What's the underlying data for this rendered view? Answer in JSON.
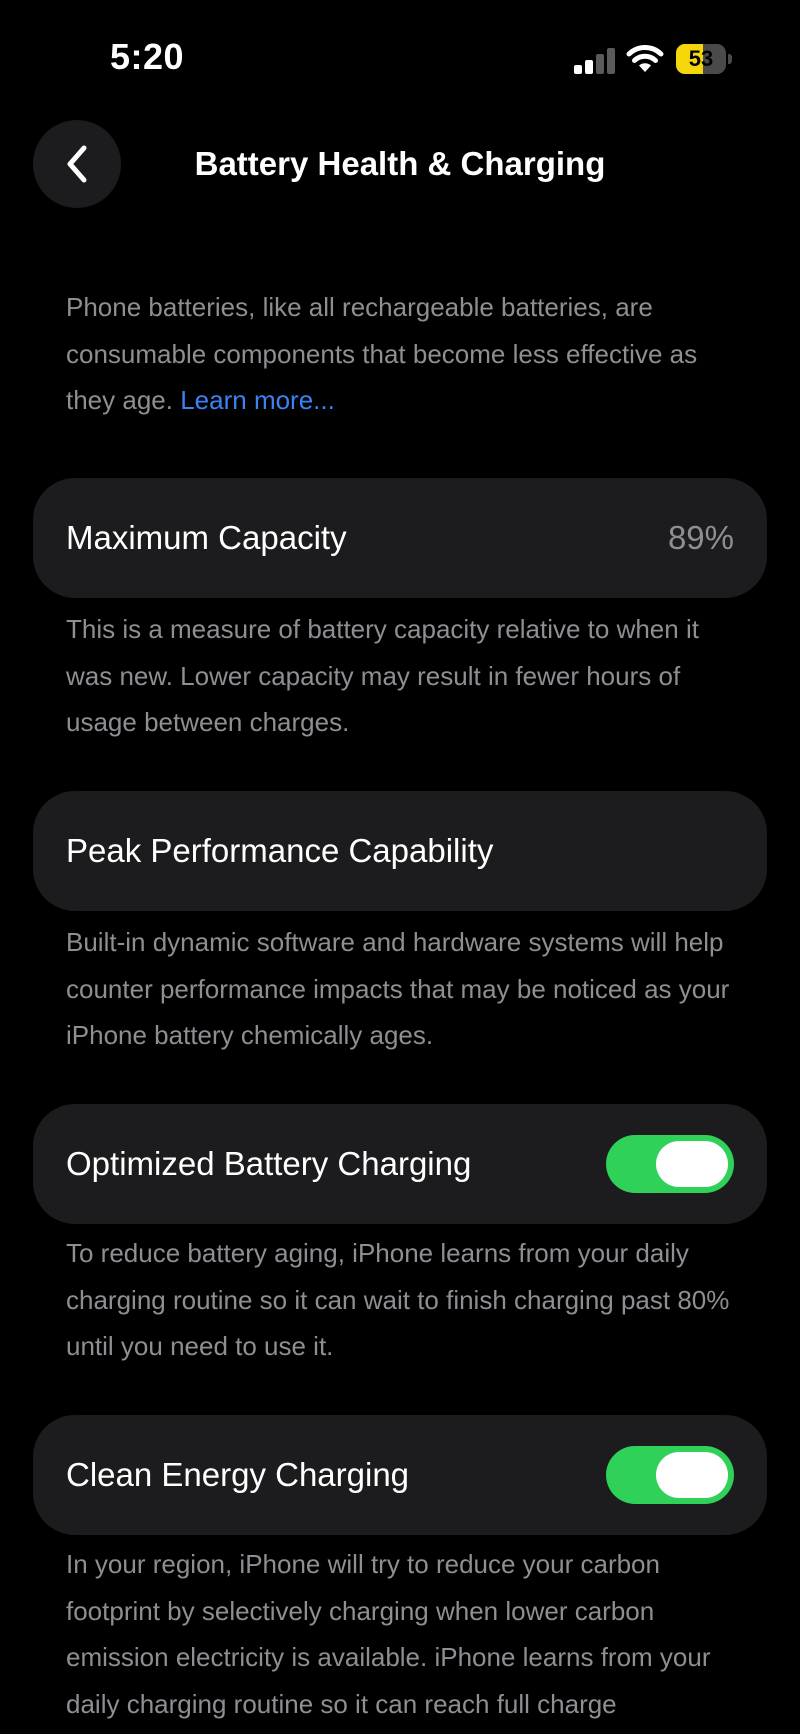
{
  "status_bar": {
    "time": "5:20",
    "battery_level": "53",
    "battery_fraction": 0.53,
    "icons": [
      "cellular-signal-icon",
      "wifi-icon",
      "battery-icon"
    ],
    "battery_color": "#f5d60a"
  },
  "nav": {
    "back_icon": "chevron-left-icon",
    "title": "Battery Health & Charging"
  },
  "intro": {
    "text": "Phone batteries, like all rechargeable batteries, are consumable components that become less effective as they age.",
    "link_label": "Learn more..."
  },
  "max_capacity": {
    "label": "Maximum Capacity",
    "value": "89%",
    "description": "This is a measure of battery capacity relative to when it was new. Lower capacity may result in fewer hours of usage between charges."
  },
  "peak_performance": {
    "label": "Peak Performance Capability",
    "description": "Built-in dynamic software and hardware systems will help counter performance impacts that may be noticed as your iPhone battery chemically ages."
  },
  "optimized_charging": {
    "label": "Optimized Battery Charging",
    "enabled": true,
    "description": "To reduce battery aging, iPhone learns from your daily charging routine so it can wait to finish charging past 80% until you need to use it."
  },
  "clean_energy": {
    "label": "Clean Energy Charging",
    "enabled": true,
    "description": "In your region, iPhone will try to reduce your carbon footprint by selectively charging when lower carbon emission electricity is available. iPhone learns from your daily charging routine so it can reach full charge"
  },
  "colors": {
    "background": "#000000",
    "card": "#1c1c1e",
    "secondary_text": "#8e8e93",
    "link": "#3b82f6",
    "toggle_on": "#30d158"
  }
}
